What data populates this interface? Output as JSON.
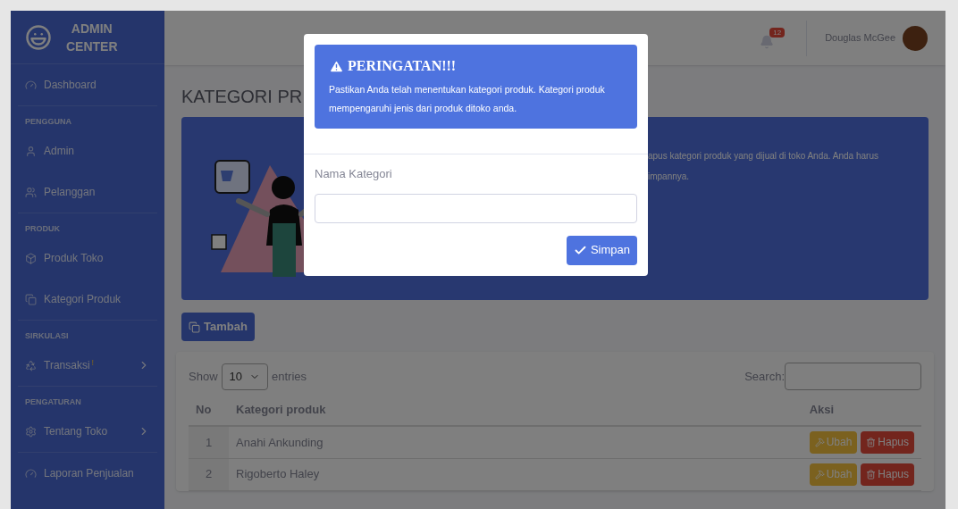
{
  "sidebar": {
    "brand": [
      "ADMIN",
      "CENTER"
    ],
    "items": [
      {
        "kind": "link",
        "label": "Dashboard",
        "submenu": false
      },
      {
        "kind": "heading",
        "label": "PENGGUNA"
      },
      {
        "kind": "link",
        "label": "Admin",
        "submenu": false
      },
      {
        "kind": "link",
        "label": "Pelanggan",
        "submenu": false
      },
      {
        "kind": "heading",
        "label": "PRODUK"
      },
      {
        "kind": "link",
        "label": "Produk Toko",
        "submenu": false
      },
      {
        "kind": "link",
        "label": "Kategori Produk",
        "submenu": false
      },
      {
        "kind": "heading",
        "label": "SIRKULASI"
      },
      {
        "kind": "link",
        "label": "Transaksi",
        "badge": "!",
        "submenu": true
      },
      {
        "kind": "heading",
        "label": "PENGATURAN"
      },
      {
        "kind": "link",
        "label": "Tentang Toko",
        "submenu": true
      },
      {
        "kind": "link",
        "label": "Laporan Penjualan",
        "submenu": false
      }
    ]
  },
  "topbar": {
    "notifications": "12",
    "user_name": "Douglas McGee"
  },
  "page_title": "KATEGORI PR",
  "banner": {
    "lines": [
      "apus kategori produk yang dijual di toko Anda. Anda harus",
      "impannya."
    ]
  },
  "add_button": "Tambah",
  "table": {
    "show_label": "Show",
    "page_size": "10",
    "entries_label": "entries",
    "search_label": "Search:",
    "columns": [
      "No",
      "Kategori produk",
      "Aksi"
    ],
    "rows": [
      {
        "no": "1",
        "name": "Anahi Ankunding",
        "actions": [
          "Ubah",
          "Hapus"
        ]
      },
      {
        "no": "2",
        "name": "Rigoberto Haley",
        "actions": [
          "Ubah",
          "Hapus"
        ]
      }
    ]
  },
  "modal": {
    "alert_title": "PERINGATAN!!!",
    "alert_text": "Pastikan Anda telah menentukan kategori produk. Kategori produk mempengaruhi jenis dari produk ditoko anda.",
    "field_label": "Nama Kategori",
    "save_button": "Simpan"
  }
}
